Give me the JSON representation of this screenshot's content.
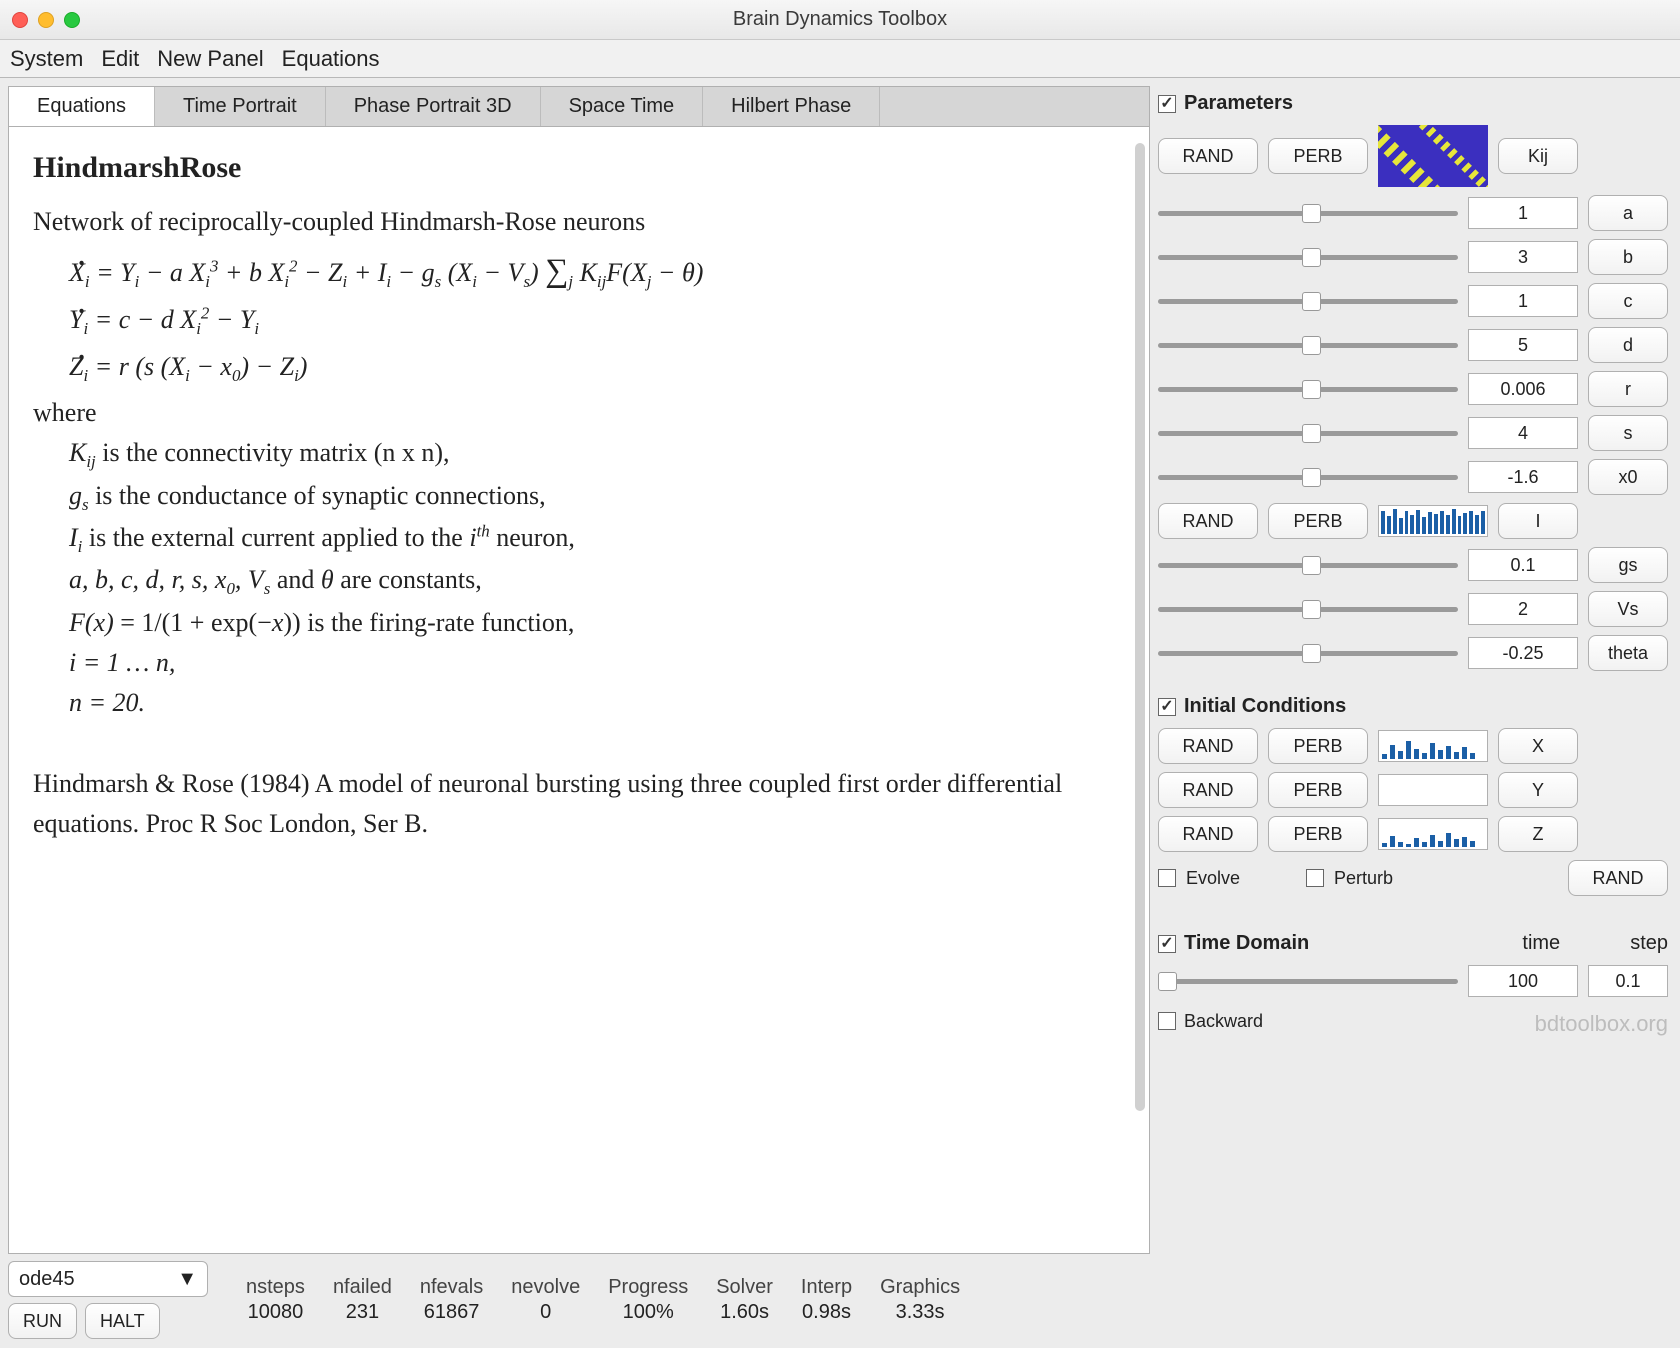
{
  "window": {
    "title": "Brain Dynamics Toolbox"
  },
  "menu": {
    "system": "System",
    "edit": "Edit",
    "newpanel": "New Panel",
    "equations": "Equations"
  },
  "tabs": {
    "equations": "Equations",
    "time": "Time Portrait",
    "phase3d": "Phase Portrait 3D",
    "spacetime": "Space Time",
    "hilbert": "Hilbert Phase"
  },
  "doc": {
    "title": "HindmarshRose",
    "intro": "Network of reciprocally-coupled Hindmarsh-Rose neurons",
    "where": "where",
    "line_K": "  is the connectivity matrix (n x n),",
    "line_gs": "  is the conductance of synaptic connections,",
    "line_I_a": "  is the external current applied to the ",
    "line_I_b": " neuron,",
    "line_const": " are constants,",
    "line_F": "  is the firing-rate function,",
    "line_i": "i = 1 … n,",
    "line_n": "n = 20.",
    "ref": "Hindmarsh & Rose (1984) A model of neuronal bursting using three coupled first order differential equations. Proc R Soc London, Ser B."
  },
  "solver": {
    "selected": "ode45",
    "run": "RUN",
    "halt": "HALT",
    "headers": {
      "nsteps": "nsteps",
      "nfailed": "nfailed",
      "nfevals": "nfevals",
      "nevolve": "nevolve",
      "progress": "Progress",
      "solver": "Solver",
      "interp": "Interp",
      "graphics": "Graphics"
    },
    "values": {
      "nsteps": "10080",
      "nfailed": "231",
      "nfevals": "61867",
      "nevolve": "0",
      "progress": "100%",
      "solver": "1.60s",
      "interp": "0.98s",
      "graphics": "3.33s"
    }
  },
  "params": {
    "title": "Parameters",
    "rand": "RAND",
    "perb": "PERB",
    "rows": [
      {
        "v": "1",
        "l": "a"
      },
      {
        "v": "3",
        "l": "b"
      },
      {
        "v": "1",
        "l": "c"
      },
      {
        "v": "5",
        "l": "d"
      },
      {
        "v": "0.006",
        "l": "r"
      },
      {
        "v": "4",
        "l": "s"
      },
      {
        "v": "-1.6",
        "l": "x0"
      }
    ],
    "rows2": [
      {
        "v": "0.1",
        "l": "gs"
      },
      {
        "v": "2",
        "l": "Vs"
      },
      {
        "v": "-0.25",
        "l": "theta"
      }
    ],
    "kij": "Kij",
    "I": "I"
  },
  "ic": {
    "title": "Initial Conditions",
    "rows": [
      {
        "l": "X"
      },
      {
        "l": "Y"
      },
      {
        "l": "Z"
      }
    ],
    "evolve": "Evolve",
    "perturb": "Perturb",
    "rand": "RAND",
    "perb": "PERB",
    "randbig": "RAND"
  },
  "time": {
    "title": "Time Domain",
    "time_h": "time",
    "step_h": "step",
    "time_v": "100",
    "step_v": "0.1",
    "backward": "Backward"
  },
  "footer": "bdtoolbox.org"
}
